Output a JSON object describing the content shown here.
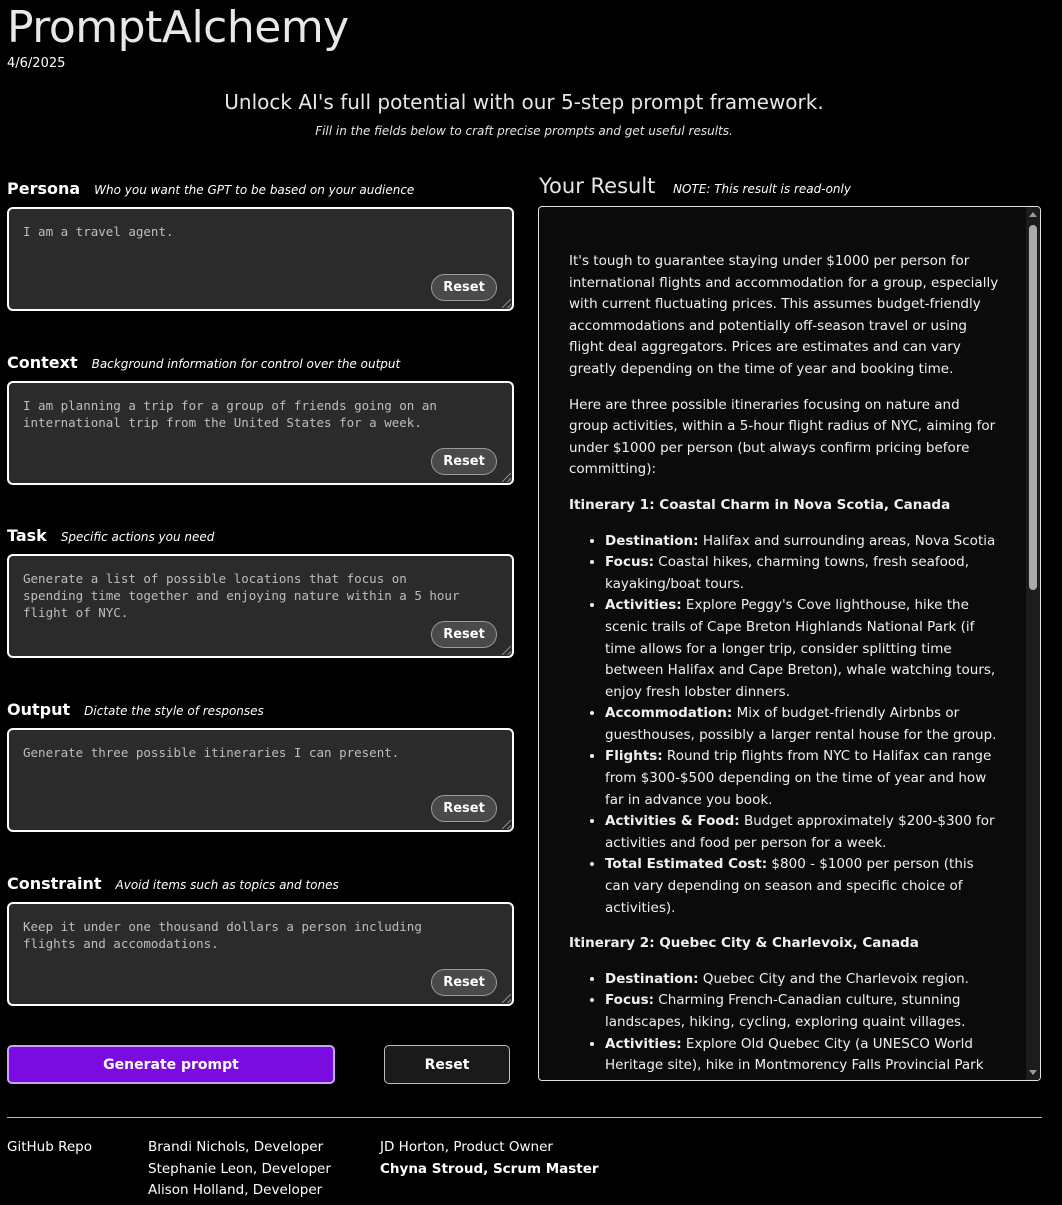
{
  "header": {
    "app_title": "PromptAlchemy",
    "date": "4/6/2025",
    "tagline": "Unlock AI's full potential with our 5-step prompt framework.",
    "subtagline": "Fill in the fields below to craft precise prompts and get useful results."
  },
  "fields": [
    {
      "label": "Persona",
      "hint": "Who you want the GPT to be based on your audience",
      "value": "I am a travel agent.",
      "reset_label": "Reset"
    },
    {
      "label": "Context",
      "hint": "Background information for control over the output",
      "value": "I am planning a trip for a group of friends going on an international trip from the United States for a week.",
      "reset_label": "Reset"
    },
    {
      "label": "Task",
      "hint": "Specific actions you need",
      "value": "Generate a list of possible locations that focus on spending time together and enjoying nature within a 5 hour flight of NYC.",
      "reset_label": "Reset"
    },
    {
      "label": "Output",
      "hint": "Dictate the style of responses",
      "value": "Generate three possible itineraries I can present.",
      "reset_label": "Reset"
    },
    {
      "label": "Constraint",
      "hint": "Avoid items such as topics and tones",
      "value": "Keep it under one thousand dollars a person including flights and accomodations.",
      "reset_label": "Reset"
    }
  ],
  "actions": {
    "generate_label": "Generate prompt",
    "reset_all_label": "Reset"
  },
  "result": {
    "title": "Your Result",
    "note": "NOTE: This result is read-only",
    "intro_1": "It's tough to guarantee staying under $1000 per person for international flights and accommodation for a group, especially with current fluctuating prices. This assumes budget-friendly accommodations and potentially off-season travel or using flight deal aggregators. Prices are estimates and can vary greatly depending on the time of year and booking time.",
    "intro_2": "Here are three possible itineraries focusing on nature and group activities, within a 5-hour flight radius of NYC, aiming for under $1000 per person (but always confirm pricing before committing):",
    "itineraries": [
      {
        "title": "Itinerary 1: Coastal Charm in Nova Scotia, Canada",
        "items": [
          {
            "key": "Destination:",
            "text": " Halifax and surrounding areas, Nova Scotia"
          },
          {
            "key": "Focus:",
            "text": " Coastal hikes, charming towns, fresh seafood, kayaking/boat tours."
          },
          {
            "key": "Activities:",
            "text": " Explore Peggy's Cove lighthouse, hike the scenic trails of Cape Breton Highlands National Park (if time allows for a longer trip, consider splitting time between Halifax and Cape Breton), whale watching tours, enjoy fresh lobster dinners."
          },
          {
            "key": "Accommodation:",
            "text": " Mix of budget-friendly Airbnbs or guesthouses, possibly a larger rental house for the group."
          },
          {
            "key": "Flights:",
            "text": " Round trip flights from NYC to Halifax can range from $300-$500 depending on the time of year and how far in advance you book."
          },
          {
            "key": "Activities & Food:",
            "text": " Budget approximately $200-$300 for activities and food per person for a week."
          },
          {
            "key": "Total Estimated Cost:",
            "text": " $800 - $1000 per person (this can vary depending on season and specific choice of activities)."
          }
        ]
      },
      {
        "title": "Itinerary 2: Quebec City & Charlevoix, Canada",
        "items": [
          {
            "key": "Destination:",
            "text": " Quebec City and the Charlevoix region."
          },
          {
            "key": "Focus:",
            "text": " Charming French-Canadian culture, stunning landscapes, hiking, cycling, exploring quaint villages."
          },
          {
            "key": "Activities:",
            "text": " Explore Old Quebec City (a UNESCO World Heritage site), hike in Montmorency Falls Provincial Park (higher than Niagara Falls!), bike along the St. Lawrence River, take a scenic drive through Charlevoix, visit charming villages"
          }
        ]
      }
    ]
  },
  "footer": {
    "repo_label": "GitHub Repo",
    "team_col1": [
      "Brandi Nichols, Developer",
      "Stephanie Leon, Developer",
      "Alison Holland, Developer"
    ],
    "team_col2_plain": "JD Horton, Product Owner",
    "team_col2_bold": "Chyna Stroud, Scrum Master"
  },
  "colors": {
    "background": "#000000",
    "field_bg": "#2b2b2b",
    "generate_button": "#7b0ce0"
  }
}
